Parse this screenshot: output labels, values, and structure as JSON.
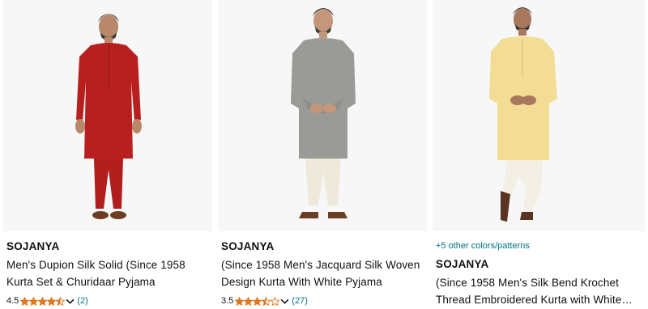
{
  "products": [
    {
      "brand": "SOJANYA",
      "title_line1": "Men's Dupion Silk Solid (Since 1958",
      "title_line2": "Kurta Set & Churidaar Pyjama",
      "rating": "4.5",
      "stars": 4.5,
      "review_count": "(2)",
      "kurta_color": "#b8201f",
      "pant_color": "#b01e1e"
    },
    {
      "brand": "SOJANYA",
      "title_line1": "(Since 1958 Men's Jacquard Silk Woven",
      "title_line2": "Design Kurta With White Pyjama",
      "rating": "3.5",
      "stars": 3.5,
      "review_count": "(27)",
      "kurta_color": "#9a9a96",
      "pant_color": "#efe9dc"
    },
    {
      "variants": "+5 other colors/patterns",
      "brand": "SOJANYA",
      "title_line1": "(Since 1958 Men's Silk Bend Krochet",
      "title_line2": "Thread Embroidered Kurta with White…",
      "kurta_color": "#f3dd95",
      "pant_color": "#f4efe4"
    }
  ],
  "colors": {
    "star": "#de7921",
    "link": "#007185",
    "image_bg": "#f7f7f7"
  }
}
